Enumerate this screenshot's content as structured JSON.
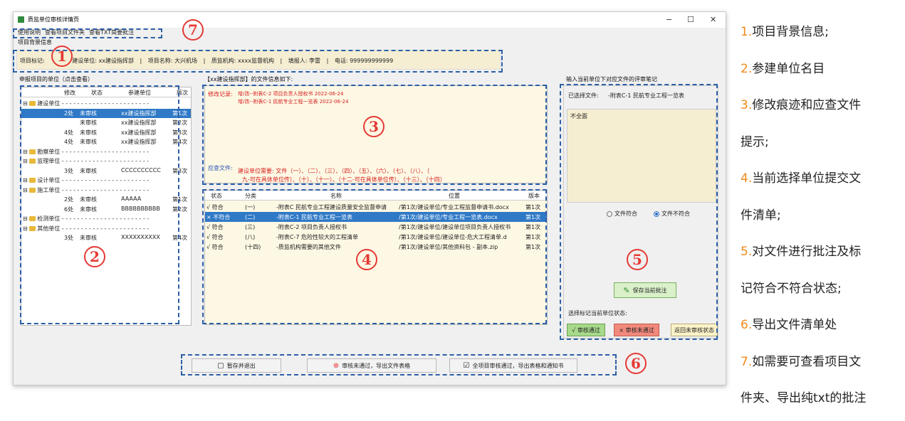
{
  "window": {
    "title": "质监单位审核详情页",
    "min": "−",
    "max": "☐",
    "close": "✕",
    "icon": "app-icon"
  },
  "menu": [
    "使用说明",
    "查看项目文件夹",
    "查看TXT简要批注"
  ],
  "info": {
    "group": "项目背景信息",
    "label": "项目标记:",
    "company": "建设单位: xx建设指挥部",
    "sep": "|",
    "project": "项目名称: 大兴机场",
    "supervisor": "质监机构: xxxx监督机构",
    "reporter": "填报人: 李雷",
    "phone": "电话: 999999999999"
  },
  "units": {
    "group": "申报项目的单位（点击查看）",
    "headers": [
      "修改",
      "状态",
      "参建单位",
      "版次"
    ],
    "rows": [
      {
        "kind": "group",
        "name": "建设单位"
      },
      {
        "kind": "row",
        "mod": "2处",
        "status": "未审核",
        "unit": "xx建设指挥部",
        "ver": "第1次",
        "selected": true
      },
      {
        "kind": "row",
        "mod": "",
        "status": "未审核",
        "unit": "xx建设指挥部",
        "ver": "第2次"
      },
      {
        "kind": "row",
        "mod": "4处",
        "status": "未审核",
        "unit": "xx建设指挥部",
        "ver": "第3次"
      },
      {
        "kind": "row",
        "mod": "4处",
        "status": "未审核",
        "unit": "xx建设指挥部",
        "ver": "第4次"
      },
      {
        "kind": "group",
        "name": "勘察单位"
      },
      {
        "kind": "group",
        "name": "监理单位"
      },
      {
        "kind": "row",
        "mod": "3处",
        "status": "未审核",
        "unit": "CCCCCCCCCC",
        "ver": "第3次"
      },
      {
        "kind": "group",
        "name": "设计单位"
      },
      {
        "kind": "group",
        "name": "施工单位"
      },
      {
        "kind": "row",
        "mod": "2处",
        "status": "未审核",
        "unit": "AAAAA",
        "ver": "第1次"
      },
      {
        "kind": "row",
        "mod": "6处",
        "status": "未审核",
        "unit": "BBBBBBBBBB",
        "ver": "第2次"
      },
      {
        "kind": "group",
        "name": "检测单位"
      },
      {
        "kind": "group",
        "name": "其他单位"
      },
      {
        "kind": "row",
        "mod": "3处",
        "status": "未审核",
        "unit": "XXXXXXXXXX",
        "ver": "第4次"
      }
    ]
  },
  "fileinfo": {
    "group": "【xx建设指挥部】的文件信息如下:",
    "change_label": "修改记录:",
    "changes": [
      "增/改--附表C-2 项目负责人授权书  2022-06-24",
      "增/改--附表C-1 民航专业工程一览表  2022-06-24"
    ],
    "check_label": "应查文件:",
    "check_line1": "建设单位需要: 文件（一）、（二）、（三）、（四）、（五）、（六）、（七）、（八）、（",
    "check_line2": "九-可在具体单位传）、（十）、（十一）、（十二-可在具体单位传）、（十三）、（十四）"
  },
  "files": {
    "headers": [
      "状态",
      "分类",
      "名称",
      "位置",
      "版本"
    ],
    "rows": [
      {
        "status": "√ 符合",
        "cat": "(一)",
        "name": "-附表C 民航专业工程建设质量安全监督申请",
        "path": "/第1次/建设单位/专业工程监督申请书.docx",
        "ver": "第1次"
      },
      {
        "status": "× 不符合",
        "cat": "(二)",
        "name": "-附表C-1 民航专业工程一览表",
        "path": "/第1次/建设单位/专业工程一览表.docx",
        "ver": "第1次",
        "selected": true
      },
      {
        "status": "√ 符合",
        "cat": "(三)",
        "name": "-附表C-2 项目负责人授权书",
        "path": "/第1次/建设单位/建设单位项目负责人授权书",
        "ver": "第1次"
      },
      {
        "status": "√ 符合",
        "cat": "(八)",
        "name": "-附表C-7 危险性较大的工程清单",
        "path": "/第1次/建设单位/建设单位-危大工程清单.d",
        "ver": "第1次"
      },
      {
        "status": "√ 符合",
        "cat": "(十四)",
        "name": "-质监机构需要的其他文件",
        "path": "/第1次/建设单位/其他资料包 - 副本.zip",
        "ver": "第1次"
      }
    ]
  },
  "review": {
    "group": "输入当前单位下对应文件的评审笔记",
    "selected_label": "已选择文件:",
    "selected_file": "-附表C-1 民航专业工程一览表",
    "note_text": "不全面",
    "opt_ok": "文件符合",
    "opt_bad": "文件不符合",
    "save": "保存当前批注",
    "status_label": "选择标记当前单位状态:",
    "pass": "√ 审核通过",
    "fail": "× 审核未通过",
    "back": "返回未审核状态"
  },
  "actions": {
    "save_exit": "暂存并退出",
    "export_fail": "审核未通过，导出文件表格",
    "export_pass": "全项目审核通过，导出表格和通知书"
  },
  "badges": [
    "1",
    "2",
    "3",
    "4",
    "5",
    "6",
    "7"
  ],
  "notes": [
    {
      "n": "1.",
      "t": "项目背景信息;"
    },
    {
      "n": "2.",
      "t": "参建单位名目"
    },
    {
      "n": "3.",
      "t": "修改痕迹和应查文件"
    },
    {
      "n": "",
      "t": "提示;"
    },
    {
      "n": "4.",
      "t": "当前选择单位提交文"
    },
    {
      "n": "",
      "t": "件清单;"
    },
    {
      "n": "5.",
      "t": "对文件进行批注及标"
    },
    {
      "n": "",
      "t": "记符合不符合状态;"
    },
    {
      "n": "6.",
      "t": "导出文件清单处"
    },
    {
      "n": "7.",
      "t": "如需要可查看项目文"
    },
    {
      "n": "",
      "t": "件夹、导出纯txt的批注"
    }
  ],
  "colors": {
    "accent": "#2f79c7",
    "badge": "#e53935",
    "dash": "#2c5fa6",
    "note_num": "#f08a1a",
    "panel": "#fdf8e4"
  }
}
